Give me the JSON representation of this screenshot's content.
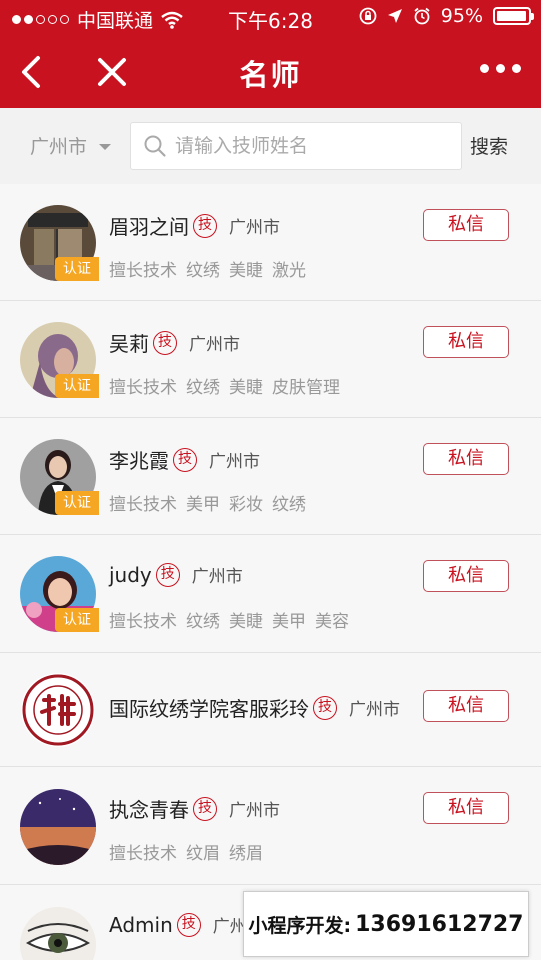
{
  "status_bar": {
    "carrier": "中国联通",
    "time": "下午6:28",
    "battery": "95%",
    "battery_level": 0.95
  },
  "nav": {
    "title": "名师",
    "back_icon": "chevron-left-icon",
    "close_icon": "close-icon",
    "more_icon": "more-dots-icon"
  },
  "search": {
    "city": "广州市",
    "placeholder": "请输入技师姓名",
    "button": "搜索"
  },
  "badge_ji": "技",
  "verified_label": "认证",
  "pm_label": "私信",
  "colors": {
    "brand": "#c8121f",
    "verified": "#f5a623"
  },
  "teachers": [
    {
      "name": "眉羽之间",
      "city": "广州市",
      "verified": true,
      "skills_label": "擅长技术",
      "skills": [
        "纹绣",
        "美睫",
        "激光"
      ]
    },
    {
      "name": "吴莉",
      "city": "广州市",
      "verified": true,
      "skills_label": "擅长技术",
      "skills": [
        "纹绣",
        "美睫",
        "皮肤管理"
      ]
    },
    {
      "name": "李兆霞",
      "city": "广州市",
      "verified": true,
      "skills_label": "擅长技术",
      "skills": [
        "美甲",
        "彩妆",
        "纹绣"
      ]
    },
    {
      "name": "judy",
      "city": "广州市",
      "verified": true,
      "skills_label": "擅长技术",
      "skills": [
        "纹绣",
        "美睫",
        "美甲",
        "美容"
      ]
    },
    {
      "name": "国际纹绣学院客服彩玲",
      "city": "广州市",
      "verified": false,
      "skills_label": "",
      "skills": []
    },
    {
      "name": "执念青春",
      "city": "广州市",
      "verified": false,
      "skills_label": "擅长技术",
      "skills": [
        "纹眉",
        "绣眉"
      ]
    },
    {
      "name": "Admin",
      "city": "广州市",
      "verified": false,
      "skills_label": "",
      "skills": []
    }
  ],
  "promo": {
    "label": "小程序开发:",
    "phone": "13691612727"
  }
}
